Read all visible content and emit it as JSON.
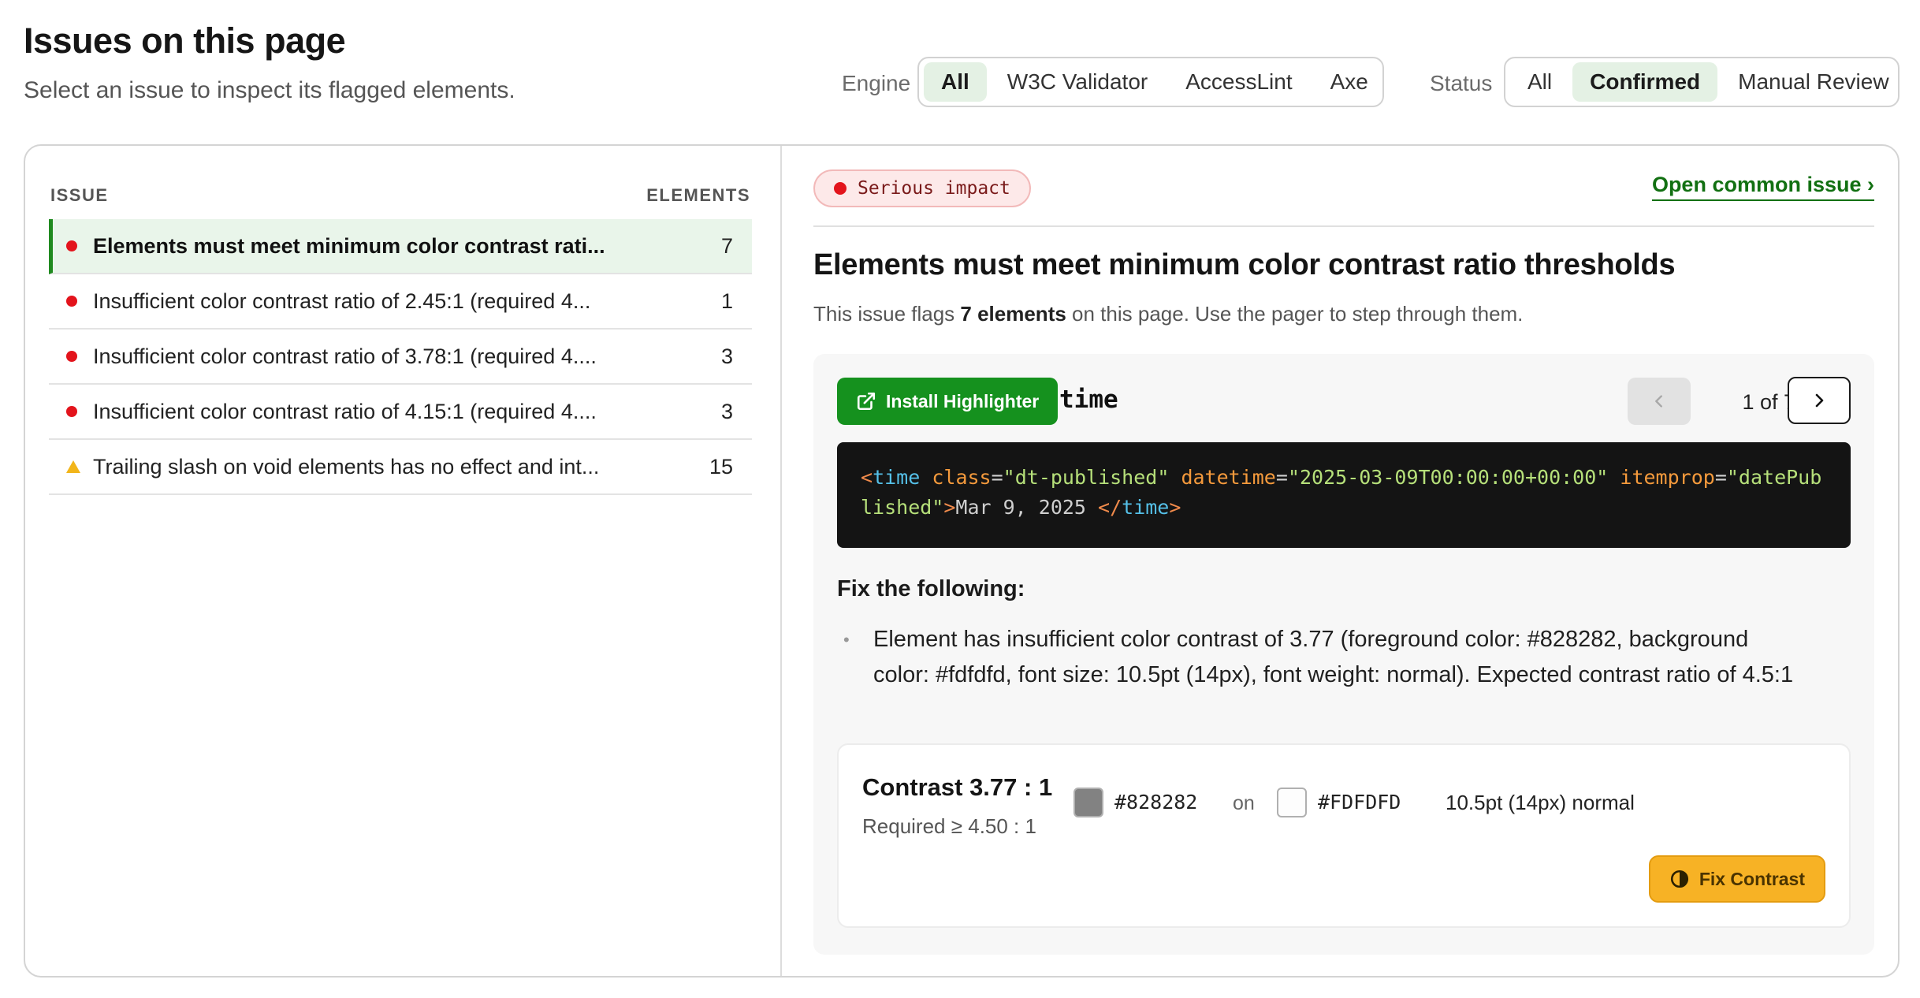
{
  "header": {
    "title": "Issues on this page",
    "subtitle": "Select an issue to inspect its flagged elements."
  },
  "filters": {
    "engine_label": "Engine",
    "engine_options": [
      "All",
      "W3C Validator",
      "AccessLint",
      "Axe"
    ],
    "engine_selected": "All",
    "status_label": "Status",
    "status_options": [
      "All",
      "Confirmed",
      "Manual Review"
    ],
    "status_selected": "Confirmed"
  },
  "issue_list": {
    "col_issue": "ISSUE",
    "col_elements": "ELEMENTS",
    "rows": [
      {
        "text": "Elements must meet minimum color contrast rati...",
        "count": "7",
        "severity": "serious",
        "selected": true
      },
      {
        "text": "Insufficient color contrast ratio of 2.45:1 (required 4...",
        "count": "1",
        "severity": "serious",
        "selected": false
      },
      {
        "text": "Insufficient color contrast ratio of 3.78:1 (required 4....",
        "count": "3",
        "severity": "serious",
        "selected": false
      },
      {
        "text": "Insufficient color contrast ratio of 4.15:1 (required 4....",
        "count": "3",
        "severity": "serious",
        "selected": false
      },
      {
        "text": "Trailing slash on void elements has no effect and int...",
        "count": "15",
        "severity": "warning",
        "selected": false
      }
    ]
  },
  "detail": {
    "impact": "Serious impact",
    "open_link": "Open common issue ›",
    "title": "Elements must meet minimum color contrast ratio thresholds",
    "desc_prefix": "This issue flags ",
    "desc_bold": "7 elements",
    "desc_suffix": " on this page. Use the pager to step through them.",
    "install_button": "Install Highlighter",
    "element_tag": "time",
    "pager_text": "1 of 7",
    "code": {
      "open_bracket": "<",
      "tag": "time",
      "attr1": "class",
      "val1": "\"dt-published\"",
      "attr2": "datetime",
      "val2": "\"2025-03-09T00:00:00+00:00\"",
      "attr3": "itemprop",
      "val3": "\"datePublished\"",
      "close_bracket": ">",
      "text": "Mar 9, 2025 ",
      "end_open": "</",
      "end_tag": "time",
      "end_close": ">"
    },
    "fix_title": "Fix the following:",
    "fix_item": "Element has insufficient color contrast of 3.77 (foreground color: #828282, background color: #fdfdfd, font size: 10.5pt (14px), font weight: normal). Expected contrast ratio of 4.5:1",
    "contrast": {
      "value": "Contrast 3.77 : 1",
      "required": "Required ≥ 4.50 : 1",
      "fg_color": "#828282",
      "fg_label": "#828282",
      "on": "on",
      "bg_color": "#FDFDFD",
      "bg_label": "#FDFDFD",
      "font_info": "10.5pt (14px) normal",
      "fix_button": "Fix Contrast"
    }
  },
  "colors": {
    "accent_green": "#15911e",
    "serious_red": "#e3141c",
    "warning_yellow": "#f2b51a",
    "fix_button_orange": "#f7b225"
  }
}
